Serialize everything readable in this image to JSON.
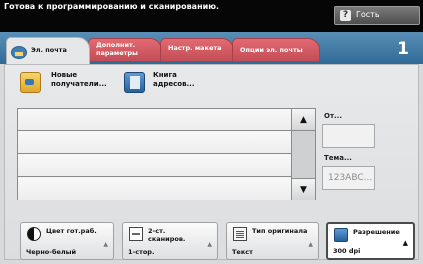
{
  "status": {
    "message": "Готова к программированию и сканированию.",
    "guest_label": "Гость",
    "guest_icon": "?"
  },
  "tabs": [
    {
      "label_line1": "Эл. почта",
      "label_line2": ""
    },
    {
      "label_line1": "Дополнит.",
      "label_line2": "параметры"
    },
    {
      "label_line1": "Настр. макета",
      "label_line2": ""
    },
    {
      "label_line1": "Опции эл. почты",
      "label_line2": ""
    }
  ],
  "job_count": "1",
  "actions": {
    "new_recipients_line1": "Новые",
    "new_recipients_line2": "получатели...",
    "address_book_line1": "Книга",
    "address_book_line2": "адресов..."
  },
  "scroll": {
    "up": "▲",
    "down": "▼"
  },
  "fields": {
    "from_label": "От...",
    "from_value": "",
    "subject_label": "Тема...",
    "subject_value": "123ABC..."
  },
  "features": [
    {
      "title_line1": "Цвет гот.раб.",
      "title_line2": "",
      "value": "Черно-белый",
      "arrow": "▲"
    },
    {
      "title_line1": "2-ст.",
      "title_line2": "сканиров.",
      "value": "1-стор.",
      "arrow": "▲"
    },
    {
      "title_line1": "Тип оригинала",
      "title_line2": "",
      "value": "Текст",
      "arrow": "▲"
    },
    {
      "title_line1": "Разрешение",
      "title_line2": "",
      "value": "300 dpi",
      "arrow": "▲"
    }
  ],
  "colors": {
    "tab_inactive": "#d25a63",
    "tab_strip": "#3f78a6",
    "status_bar": "#060606"
  }
}
